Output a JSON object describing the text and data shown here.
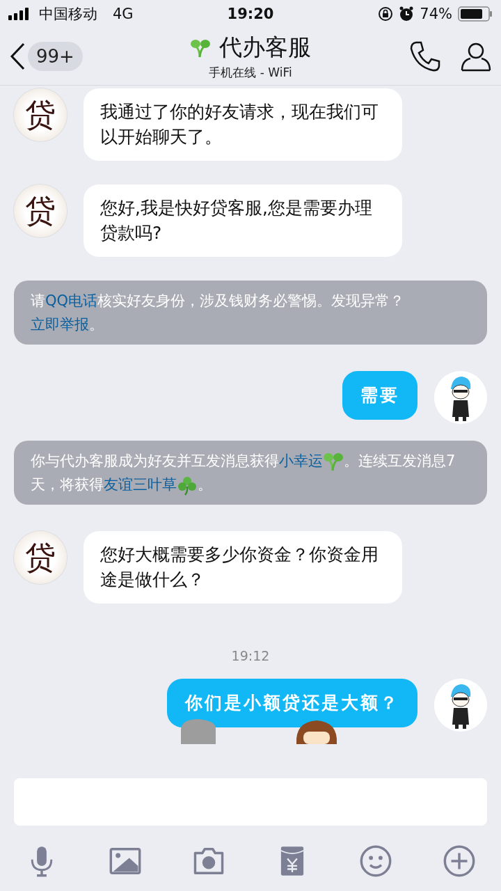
{
  "status_bar": {
    "carrier": "中国移动",
    "network": "4G",
    "time": "19:20",
    "battery": "74%"
  },
  "header": {
    "badge": "99+",
    "title": "代办客服",
    "subtitle": "手机在线 - WiFi"
  },
  "messages": [
    {
      "kind": "incoming",
      "avatar_text": "贷",
      "text": "我通过了你的好友请求，现在我们可以开始聊天了。"
    },
    {
      "kind": "incoming",
      "avatar_text": "贷",
      "text": "您好,我是快好贷客服,您是需要办理贷款吗?"
    },
    {
      "kind": "notice",
      "segments": [
        {
          "kind": "text",
          "text": "请"
        },
        {
          "kind": "link",
          "text": "QQ电话"
        },
        {
          "kind": "text",
          "text": "核实好友身份，涉及钱财务必警惕。发现异常？"
        },
        {
          "kind": "link",
          "text": "立即举报"
        },
        {
          "kind": "text",
          "text": "。"
        }
      ]
    },
    {
      "kind": "outgoing",
      "text": "需要"
    },
    {
      "kind": "notice",
      "segments": [
        {
          "kind": "text",
          "text": "你与代办客服成为好友并互发消息获得"
        },
        {
          "kind": "link",
          "text": "小幸运"
        },
        {
          "kind": "sprout"
        },
        {
          "kind": "text",
          "text": "。连续互发消息7天，将获得"
        },
        {
          "kind": "link",
          "text": "友谊三叶草"
        },
        {
          "kind": "clover"
        },
        {
          "kind": "text",
          "text": "。"
        }
      ]
    },
    {
      "kind": "incoming",
      "avatar_text": "贷",
      "text": "您好大概需要多少你资金？你资金用途是做什么？"
    },
    {
      "kind": "time",
      "text": "19:12"
    },
    {
      "kind": "outgoing",
      "text": "你们是小额贷还是大额？",
      "figures": true
    }
  ]
}
